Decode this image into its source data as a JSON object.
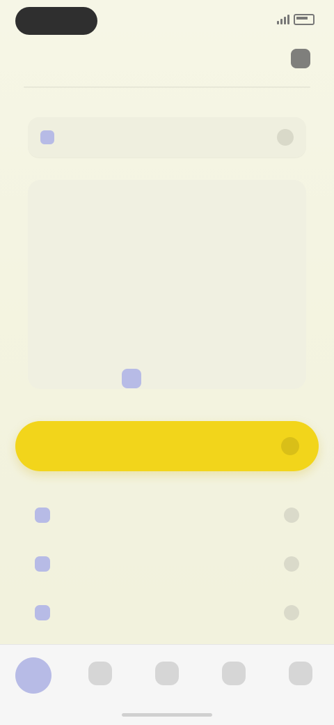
{
  "status_bar": {
    "time": "",
    "right": ""
  },
  "header": {
    "title": "",
    "settings_icon": "settings-icon"
  },
  "date_picker": {
    "label": "",
    "icon": "calendar-icon"
  },
  "calendar": {
    "title": "",
    "days": [
      "",
      "",
      "",
      "",
      "",
      "",
      "",
      "",
      "",
      "",
      "",
      "",
      "",
      "",
      "",
      "",
      "",
      "",
      "",
      "",
      "",
      "",
      "",
      "",
      "",
      "",
      "",
      "",
      "",
      "",
      "",
      "",
      "",
      "",
      ""
    ],
    "selected_index": 30
  },
  "primary_action": {
    "label": ""
  },
  "list": {
    "items": [
      {
        "label": "",
        "icon": "document-icon"
      },
      {
        "label": "",
        "icon": "clock-icon"
      },
      {
        "label": "",
        "icon": "info-icon"
      }
    ]
  },
  "bottom_nav": {
    "items": [
      {
        "label": "",
        "icon": "home-icon",
        "active": true
      },
      {
        "label": "",
        "icon": "calendar-icon",
        "active": false
      },
      {
        "label": "",
        "icon": "list-icon",
        "active": false
      },
      {
        "label": "",
        "icon": "chart-icon",
        "active": false
      },
      {
        "label": "",
        "icon": "profile-icon",
        "active": false
      }
    ]
  },
  "colors": {
    "background": "#f4f4e4",
    "accent_yellow": "#f2d51b",
    "accent_lavender": "#b7bbe6"
  }
}
